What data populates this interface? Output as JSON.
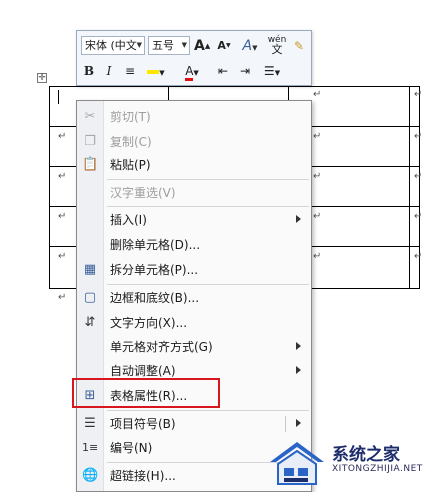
{
  "mini_toolbar": {
    "font_name": "宋体 (中文",
    "font_size": "五号",
    "grow_font_label": "A",
    "shrink_font_label": "A",
    "style_label": "A",
    "phonetic_label": "wén",
    "bold_label": "B",
    "italic_label": "I",
    "font_color_label": "A"
  },
  "table": {
    "para_mark": "↵"
  },
  "context_menu": {
    "items": [
      {
        "label": "剪切(T)",
        "icon": "scissors-icon",
        "disabled": true
      },
      {
        "label": "复制(C)",
        "icon": "copy-icon",
        "disabled": true
      },
      {
        "label": "粘贴(P)",
        "icon": "paste-icon",
        "disabled": false
      },
      {
        "label": "汉字重选(V)",
        "icon": "",
        "disabled": true
      },
      {
        "label": "插入(I)",
        "icon": "",
        "disabled": false,
        "submenu": true
      },
      {
        "label": "删除单元格(D)...",
        "icon": "",
        "disabled": false
      },
      {
        "label": "拆分单元格(P)...",
        "icon": "split-cells-icon",
        "disabled": false
      },
      {
        "label": "边框和底纹(B)...",
        "icon": "borders-icon",
        "disabled": false
      },
      {
        "label": "文字方向(X)...",
        "icon": "text-direction-icon",
        "disabled": false
      },
      {
        "label": "单元格对齐方式(G)",
        "icon": "",
        "disabled": false,
        "submenu": true
      },
      {
        "label": "自动调整(A)",
        "icon": "",
        "disabled": false,
        "submenu": true
      },
      {
        "label": "表格属性(R)...",
        "icon": "table-properties-icon",
        "disabled": false
      },
      {
        "label": "项目符号(B)",
        "icon": "bullets-icon",
        "disabled": false,
        "submenu": true
      },
      {
        "label": "编号(N)",
        "icon": "numbering-icon",
        "disabled": false
      },
      {
        "label": "超链接(H)...",
        "icon": "hyperlink-icon",
        "disabled": false
      }
    ]
  },
  "watermark": {
    "site_name": "系统之家",
    "site_url": "XITONGZHIJIA.NET"
  },
  "colors": {
    "highlight_border": "#d8161e",
    "menu_bg": "#fafafa",
    "toolbar_bg": "#f3f6fb"
  }
}
